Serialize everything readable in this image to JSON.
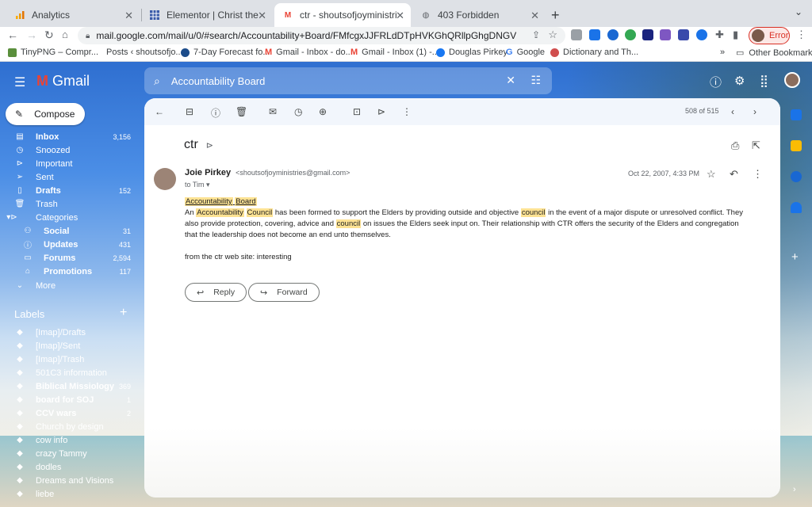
{
  "browser": {
    "tabs": [
      {
        "title": "Analytics",
        "icon": "analytics-icon",
        "color": "#f29900"
      },
      {
        "title": "Elementor | Christ the Rock Ch",
        "icon": "elementor-icon",
        "color": "#3a5ba9"
      },
      {
        "title": "ctr - shoutsofjoyministries@gm",
        "icon": "gmail-icon",
        "color": "#ea4335"
      },
      {
        "title": "403 Forbidden",
        "icon": "globe-icon",
        "color": "#5f6368"
      }
    ],
    "url": "mail.google.com/mail/u/0/#search/Accountability+Board/FMfcgxJJFRLdDTpHVKGhQRllpGhgDNGV",
    "error_label": "Error",
    "bookmarks": [
      {
        "label": "TinyPNG – Compr...",
        "color": "#5a8f3c"
      },
      {
        "label": "Posts ‹ shoutsofjo...",
        "color": "#21759b"
      },
      {
        "label": "7-Day Forecast fo...",
        "color": "#1c4c8a"
      },
      {
        "label": "Gmail - Inbox - do...",
        "color": "#ea4335"
      },
      {
        "label": "Gmail - Inbox (1) -...",
        "color": "#ea4335"
      },
      {
        "label": "Douglas Pirkey",
        "color": "#1877f2"
      },
      {
        "label": "Google",
        "color": "#4285f4"
      },
      {
        "label": "Dictionary and Th...",
        "color": "#d04e4e"
      }
    ],
    "bookmarks_more": "»",
    "other_bookmarks": "Other Bookmarks"
  },
  "gmail": {
    "app_name": "Gmail",
    "search_query": "Accountability Board",
    "compose_label": "Compose",
    "nav": [
      {
        "label": "Inbox",
        "count": "3,156",
        "bold": true,
        "icon": "inbox-icon"
      },
      {
        "label": "Snoozed",
        "count": "",
        "bold": false,
        "icon": "clock-icon"
      },
      {
        "label": "Important",
        "count": "",
        "bold": false,
        "icon": "important-icon"
      },
      {
        "label": "Sent",
        "count": "",
        "bold": false,
        "icon": "send-icon"
      },
      {
        "label": "Drafts",
        "count": "152",
        "bold": true,
        "icon": "draft-icon"
      },
      {
        "label": "Trash",
        "count": "",
        "bold": false,
        "icon": "trash-icon"
      },
      {
        "label": "Categories",
        "count": "",
        "bold": false,
        "icon": "label-icon"
      },
      {
        "label": "Social",
        "count": "31",
        "bold": true,
        "icon": "people-icon"
      },
      {
        "label": "Updates",
        "count": "431",
        "bold": true,
        "icon": "info-icon"
      },
      {
        "label": "Forums",
        "count": "2,594",
        "bold": true,
        "icon": "forum-icon"
      },
      {
        "label": "Promotions",
        "count": "117",
        "bold": true,
        "icon": "tag-icon"
      },
      {
        "label": "More",
        "count": "",
        "bold": false,
        "icon": "chevron-down-icon"
      }
    ],
    "labels_heading": "Labels",
    "labels": [
      {
        "label": "[Imap]/Drafts",
        "count": "",
        "bold": false
      },
      {
        "label": "[Imap]/Sent",
        "count": "",
        "bold": false
      },
      {
        "label": "[Imap]/Trash",
        "count": "",
        "bold": false
      },
      {
        "label": "501C3 information",
        "count": "",
        "bold": false
      },
      {
        "label": "Biblical Missiology",
        "count": "369",
        "bold": true
      },
      {
        "label": "board for SOJ",
        "count": "1",
        "bold": true
      },
      {
        "label": "CCV wars",
        "count": "2",
        "bold": true
      },
      {
        "label": "Church by design",
        "count": "",
        "bold": false
      },
      {
        "label": "cow info",
        "count": "",
        "bold": false
      },
      {
        "label": "crazy Tammy",
        "count": "",
        "bold": false
      },
      {
        "label": "dodles",
        "count": "",
        "bold": false
      },
      {
        "label": "Dreams and Visions",
        "count": "",
        "bold": false
      },
      {
        "label": "liebe",
        "count": "",
        "bold": false
      }
    ],
    "pager": "508 of 515",
    "message": {
      "subject": "ctr",
      "sender_name": "Joie Pirkey",
      "sender_email": "<shoutsofjoyministries@gmail.com>",
      "to": "to Tim",
      "date": "Oct 22, 2007, 4:33 PM",
      "heading_a": "Accountability",
      "heading_b": "Board",
      "p1_a": "An ",
      "p1_hl1": "Accountability",
      "p1_hl2": "Council",
      "p1_b": " has been formed to support the Elders by providing outside and objective ",
      "p1_hl3": "council",
      "p1_c": " in the event of a major dispute or unresolved conflict. They also provide protection, covering, advice and ",
      "p1_hl4": "council",
      "p1_d": " on issues the Elders seek input on. Their relationship with CTR offers the security of the Elders and congregation that the leadership does not become an end unto themselves.",
      "p2": "from the ctr web site: interesting"
    },
    "reply_label": "Reply",
    "forward_label": "Forward"
  }
}
